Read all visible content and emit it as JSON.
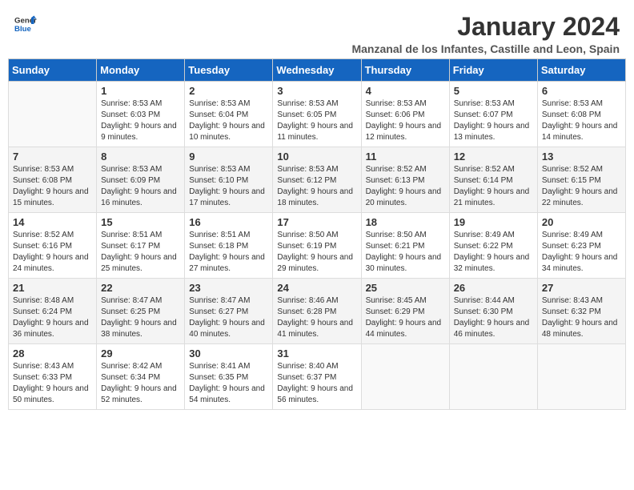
{
  "logo": {
    "text_general": "General",
    "text_blue": "Blue"
  },
  "title": "January 2024",
  "location": "Manzanal de los Infantes, Castille and Leon, Spain",
  "weekdays": [
    "Sunday",
    "Monday",
    "Tuesday",
    "Wednesday",
    "Thursday",
    "Friday",
    "Saturday"
  ],
  "weeks": [
    [
      {
        "day": "",
        "sunrise": "",
        "sunset": "",
        "daylight": ""
      },
      {
        "day": "1",
        "sunrise": "Sunrise: 8:53 AM",
        "sunset": "Sunset: 6:03 PM",
        "daylight": "Daylight: 9 hours and 9 minutes."
      },
      {
        "day": "2",
        "sunrise": "Sunrise: 8:53 AM",
        "sunset": "Sunset: 6:04 PM",
        "daylight": "Daylight: 9 hours and 10 minutes."
      },
      {
        "day": "3",
        "sunrise": "Sunrise: 8:53 AM",
        "sunset": "Sunset: 6:05 PM",
        "daylight": "Daylight: 9 hours and 11 minutes."
      },
      {
        "day": "4",
        "sunrise": "Sunrise: 8:53 AM",
        "sunset": "Sunset: 6:06 PM",
        "daylight": "Daylight: 9 hours and 12 minutes."
      },
      {
        "day": "5",
        "sunrise": "Sunrise: 8:53 AM",
        "sunset": "Sunset: 6:07 PM",
        "daylight": "Daylight: 9 hours and 13 minutes."
      },
      {
        "day": "6",
        "sunrise": "Sunrise: 8:53 AM",
        "sunset": "Sunset: 6:08 PM",
        "daylight": "Daylight: 9 hours and 14 minutes."
      }
    ],
    [
      {
        "day": "7",
        "sunrise": "Sunrise: 8:53 AM",
        "sunset": "Sunset: 6:08 PM",
        "daylight": "Daylight: 9 hours and 15 minutes."
      },
      {
        "day": "8",
        "sunrise": "Sunrise: 8:53 AM",
        "sunset": "Sunset: 6:09 PM",
        "daylight": "Daylight: 9 hours and 16 minutes."
      },
      {
        "day": "9",
        "sunrise": "Sunrise: 8:53 AM",
        "sunset": "Sunset: 6:10 PM",
        "daylight": "Daylight: 9 hours and 17 minutes."
      },
      {
        "day": "10",
        "sunrise": "Sunrise: 8:53 AM",
        "sunset": "Sunset: 6:12 PM",
        "daylight": "Daylight: 9 hours and 18 minutes."
      },
      {
        "day": "11",
        "sunrise": "Sunrise: 8:52 AM",
        "sunset": "Sunset: 6:13 PM",
        "daylight": "Daylight: 9 hours and 20 minutes."
      },
      {
        "day": "12",
        "sunrise": "Sunrise: 8:52 AM",
        "sunset": "Sunset: 6:14 PM",
        "daylight": "Daylight: 9 hours and 21 minutes."
      },
      {
        "day": "13",
        "sunrise": "Sunrise: 8:52 AM",
        "sunset": "Sunset: 6:15 PM",
        "daylight": "Daylight: 9 hours and 22 minutes."
      }
    ],
    [
      {
        "day": "14",
        "sunrise": "Sunrise: 8:52 AM",
        "sunset": "Sunset: 6:16 PM",
        "daylight": "Daylight: 9 hours and 24 minutes."
      },
      {
        "day": "15",
        "sunrise": "Sunrise: 8:51 AM",
        "sunset": "Sunset: 6:17 PM",
        "daylight": "Daylight: 9 hours and 25 minutes."
      },
      {
        "day": "16",
        "sunrise": "Sunrise: 8:51 AM",
        "sunset": "Sunset: 6:18 PM",
        "daylight": "Daylight: 9 hours and 27 minutes."
      },
      {
        "day": "17",
        "sunrise": "Sunrise: 8:50 AM",
        "sunset": "Sunset: 6:19 PM",
        "daylight": "Daylight: 9 hours and 29 minutes."
      },
      {
        "day": "18",
        "sunrise": "Sunrise: 8:50 AM",
        "sunset": "Sunset: 6:21 PM",
        "daylight": "Daylight: 9 hours and 30 minutes."
      },
      {
        "day": "19",
        "sunrise": "Sunrise: 8:49 AM",
        "sunset": "Sunset: 6:22 PM",
        "daylight": "Daylight: 9 hours and 32 minutes."
      },
      {
        "day": "20",
        "sunrise": "Sunrise: 8:49 AM",
        "sunset": "Sunset: 6:23 PM",
        "daylight": "Daylight: 9 hours and 34 minutes."
      }
    ],
    [
      {
        "day": "21",
        "sunrise": "Sunrise: 8:48 AM",
        "sunset": "Sunset: 6:24 PM",
        "daylight": "Daylight: 9 hours and 36 minutes."
      },
      {
        "day": "22",
        "sunrise": "Sunrise: 8:47 AM",
        "sunset": "Sunset: 6:25 PM",
        "daylight": "Daylight: 9 hours and 38 minutes."
      },
      {
        "day": "23",
        "sunrise": "Sunrise: 8:47 AM",
        "sunset": "Sunset: 6:27 PM",
        "daylight": "Daylight: 9 hours and 40 minutes."
      },
      {
        "day": "24",
        "sunrise": "Sunrise: 8:46 AM",
        "sunset": "Sunset: 6:28 PM",
        "daylight": "Daylight: 9 hours and 41 minutes."
      },
      {
        "day": "25",
        "sunrise": "Sunrise: 8:45 AM",
        "sunset": "Sunset: 6:29 PM",
        "daylight": "Daylight: 9 hours and 44 minutes."
      },
      {
        "day": "26",
        "sunrise": "Sunrise: 8:44 AM",
        "sunset": "Sunset: 6:30 PM",
        "daylight": "Daylight: 9 hours and 46 minutes."
      },
      {
        "day": "27",
        "sunrise": "Sunrise: 8:43 AM",
        "sunset": "Sunset: 6:32 PM",
        "daylight": "Daylight: 9 hours and 48 minutes."
      }
    ],
    [
      {
        "day": "28",
        "sunrise": "Sunrise: 8:43 AM",
        "sunset": "Sunset: 6:33 PM",
        "daylight": "Daylight: 9 hours and 50 minutes."
      },
      {
        "day": "29",
        "sunrise": "Sunrise: 8:42 AM",
        "sunset": "Sunset: 6:34 PM",
        "daylight": "Daylight: 9 hours and 52 minutes."
      },
      {
        "day": "30",
        "sunrise": "Sunrise: 8:41 AM",
        "sunset": "Sunset: 6:35 PM",
        "daylight": "Daylight: 9 hours and 54 minutes."
      },
      {
        "day": "31",
        "sunrise": "Sunrise: 8:40 AM",
        "sunset": "Sunset: 6:37 PM",
        "daylight": "Daylight: 9 hours and 56 minutes."
      },
      {
        "day": "",
        "sunrise": "",
        "sunset": "",
        "daylight": ""
      },
      {
        "day": "",
        "sunrise": "",
        "sunset": "",
        "daylight": ""
      },
      {
        "day": "",
        "sunrise": "",
        "sunset": "",
        "daylight": ""
      }
    ]
  ]
}
